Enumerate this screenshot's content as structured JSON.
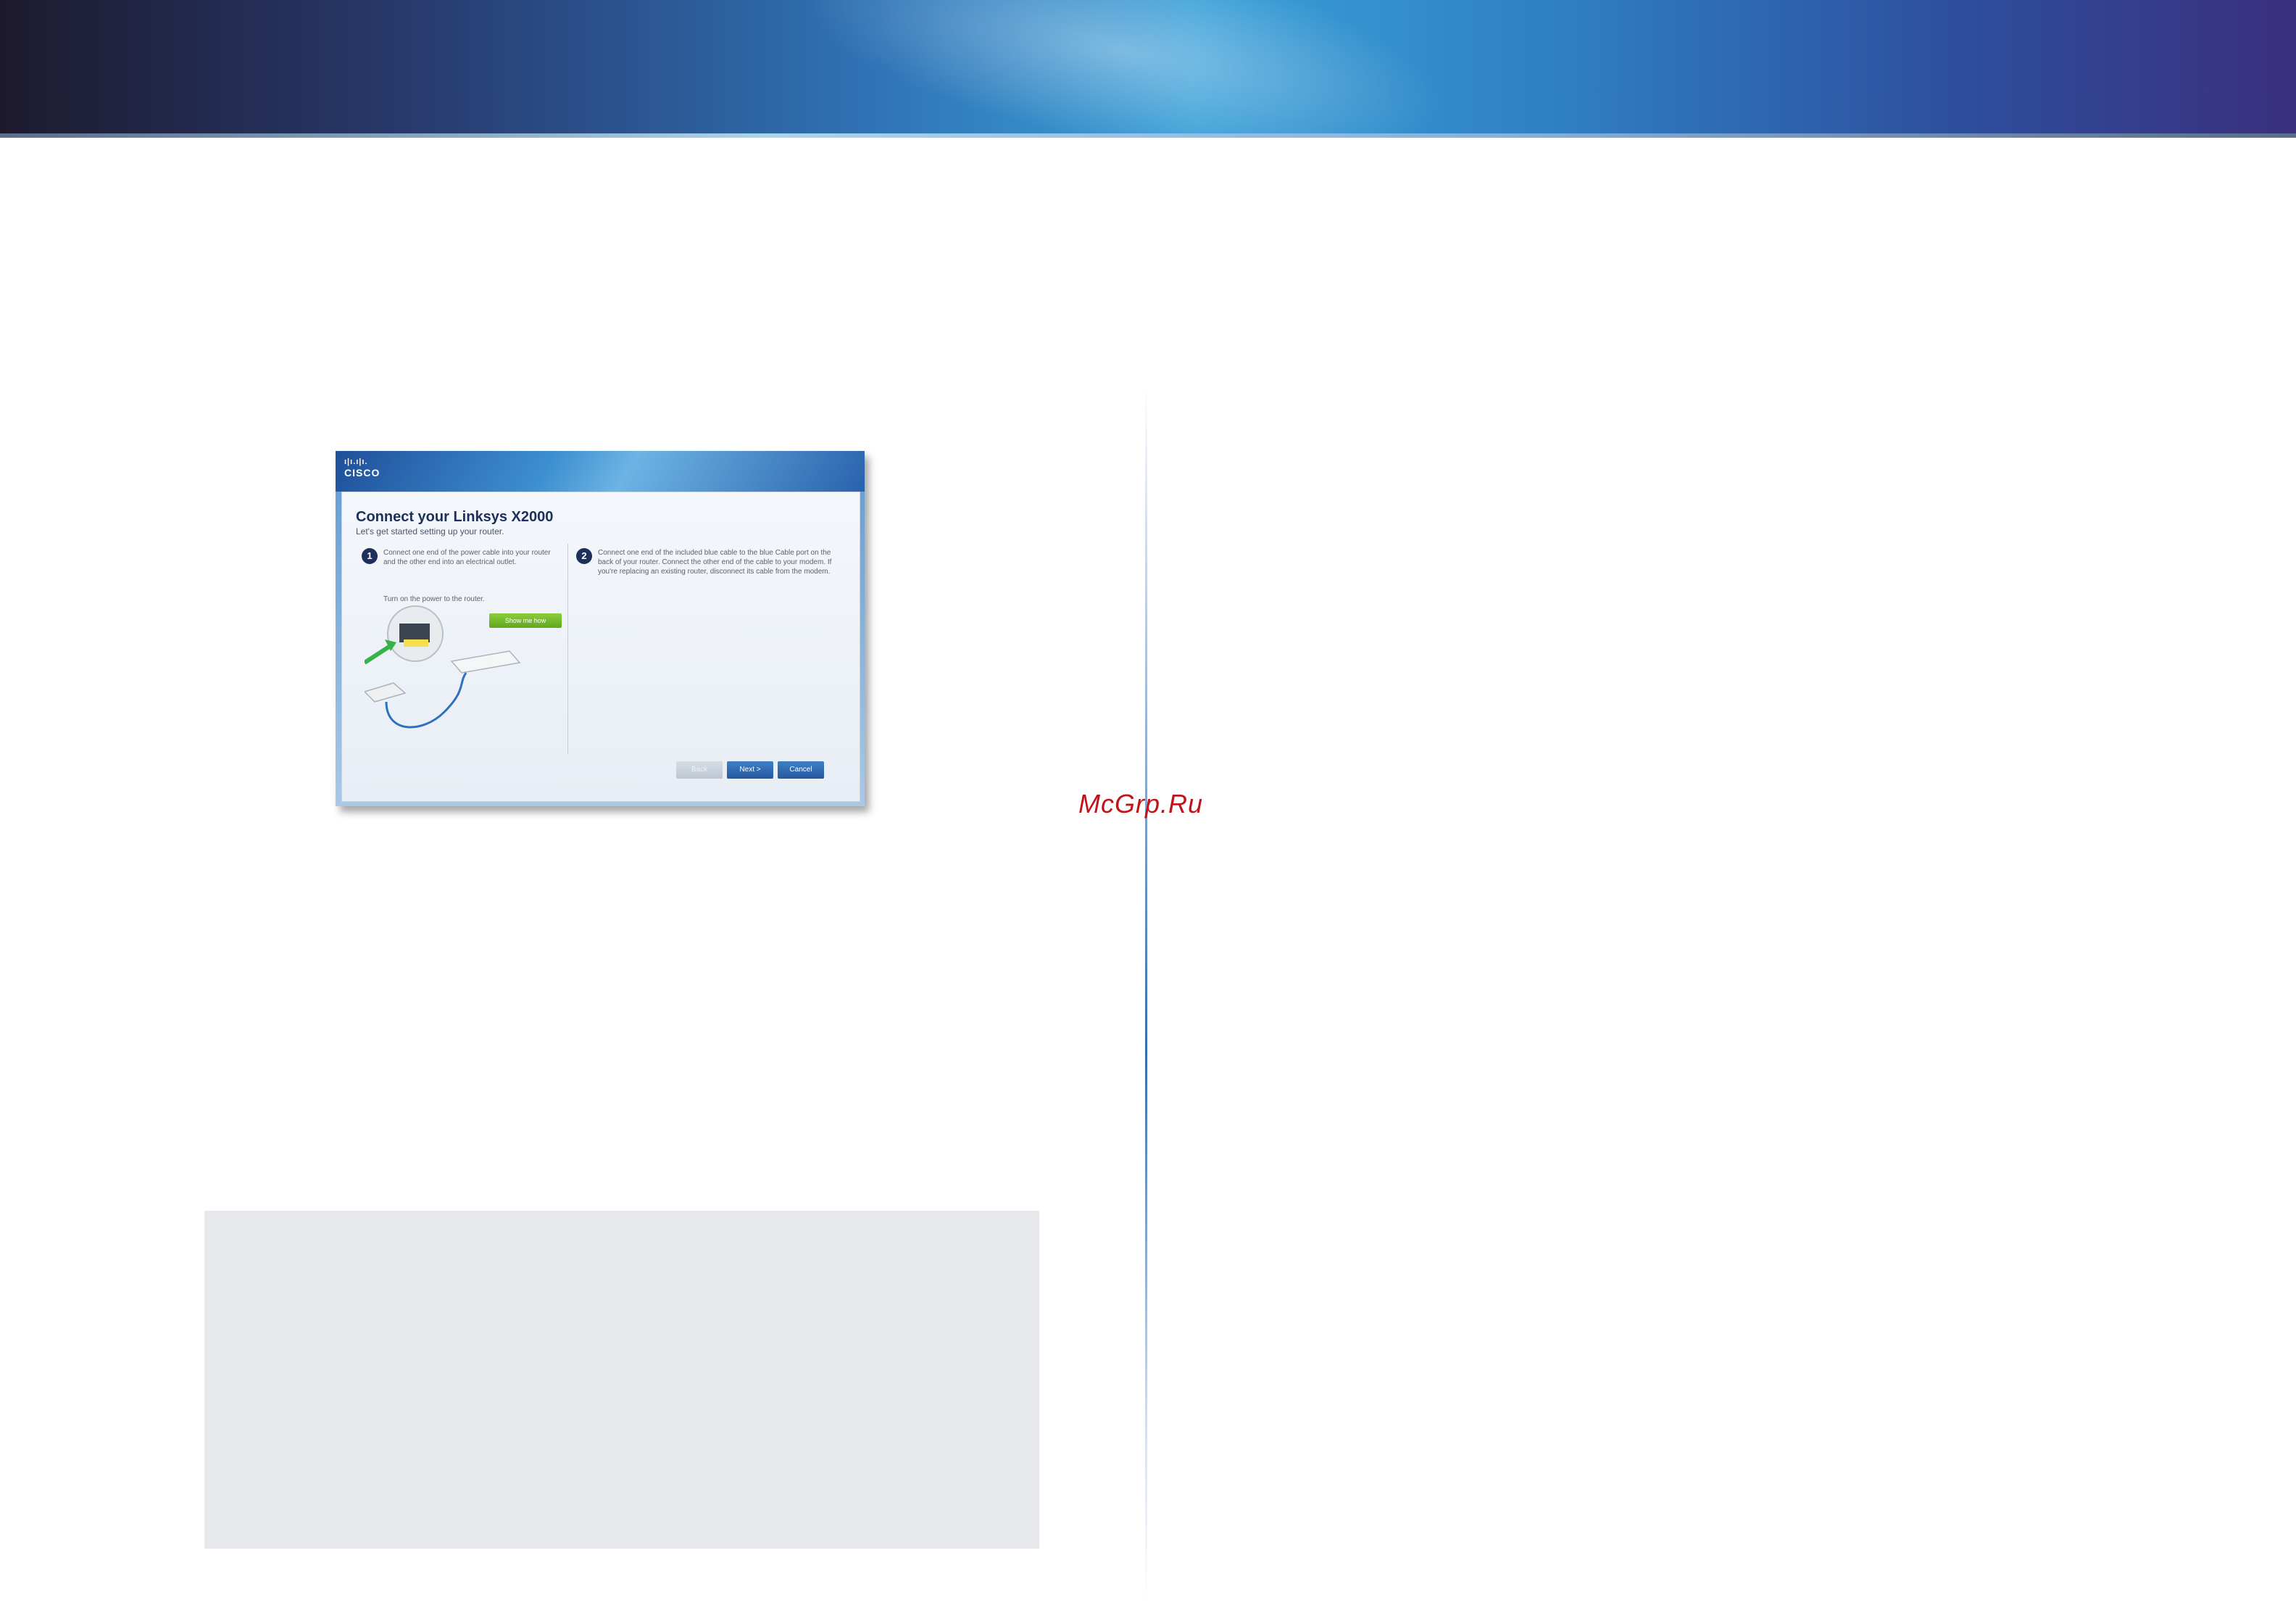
{
  "watermark": "McGrp.Ru",
  "wizard": {
    "brand": "CISCO",
    "title": "Connect your Linksys X2000",
    "subtitle": "Let's get started setting up your router.",
    "step1_number": "1",
    "step1_text": "Connect one end of the power cable into your router and the other end into an electrical outlet.",
    "step1_note": "Turn on the power to the router.",
    "show_me_label": "Show me how",
    "step2_number": "2",
    "step2_text": "Connect one end of the included blue cable to the blue Cable port on the back of your router. Connect the other end of the cable to your modem. If you're replacing an existing router, disconnect its cable from the modem.",
    "back_label": "Back",
    "next_label": "Next >",
    "cancel_label": "Cancel"
  }
}
